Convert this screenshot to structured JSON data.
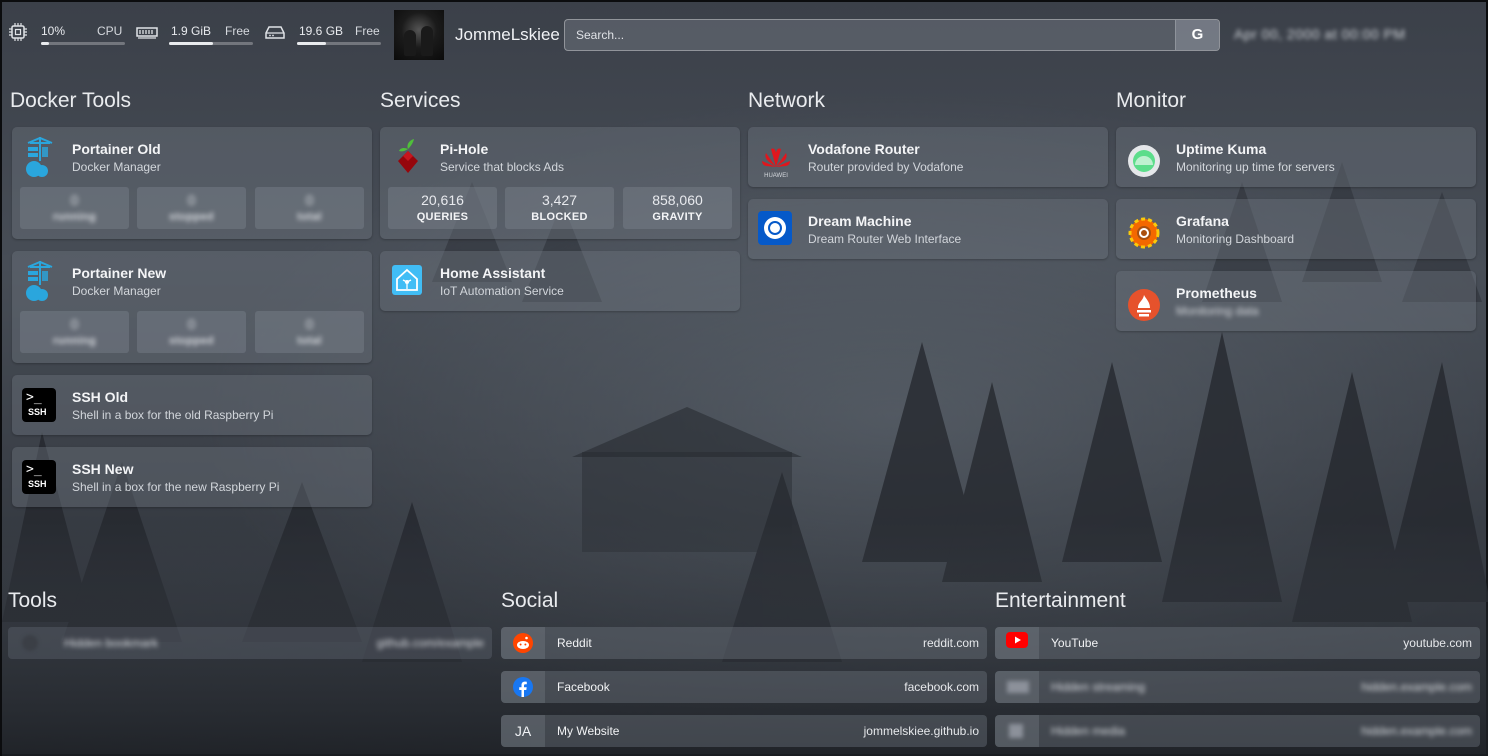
{
  "topbar": {
    "cpu": {
      "value": "10%",
      "label": "CPU",
      "percent": 10,
      "icon": "cpu-icon"
    },
    "ram": {
      "value": "1.9 GiB",
      "label": "Free",
      "percent": 52,
      "icon": "ram-icon"
    },
    "disk": {
      "value": "19.6 GB",
      "label": "Free",
      "percent": 35,
      "icon": "hard-drive-icon"
    },
    "username": "JommeLskiee",
    "search_placeholder": "Search...",
    "search_button": "G",
    "datetime": "Apr 00, 2000 at 00:00 PM"
  },
  "groups": {
    "docker": {
      "title": "Docker Tools",
      "cards": [
        {
          "name": "Portainer Old",
          "desc": "Docker Manager",
          "stats": [
            {
              "v": "0",
              "l": "running"
            },
            {
              "v": "0",
              "l": "stopped"
            },
            {
              "v": "0",
              "l": "total"
            }
          ]
        },
        {
          "name": "Portainer New",
          "desc": "Docker Manager",
          "stats": [
            {
              "v": "0",
              "l": "running"
            },
            {
              "v": "0",
              "l": "stopped"
            },
            {
              "v": "0",
              "l": "total"
            }
          ]
        },
        {
          "name": "SSH Old",
          "desc": "Shell in a box for the old Raspberry Pi",
          "icon_text": "SSH"
        },
        {
          "name": "SSH New",
          "desc": "Shell in a box for the new Raspberry Pi",
          "icon_text": "SSH"
        }
      ]
    },
    "services": {
      "title": "Services",
      "cards": [
        {
          "name": "Pi-Hole",
          "desc": "Service that blocks Ads",
          "stats": [
            {
              "v": "20,616",
              "l": "QUERIES"
            },
            {
              "v": "3,427",
              "l": "BLOCKED"
            },
            {
              "v": "858,060",
              "l": "GRAVITY"
            }
          ]
        },
        {
          "name": "Home Assistant",
          "desc": "IoT Automation Service"
        }
      ]
    },
    "network": {
      "title": "Network",
      "cards": [
        {
          "name": "Vodafone Router",
          "desc": "Router provided by Vodafone",
          "icon_text": "HUAWEI"
        },
        {
          "name": "Dream Machine",
          "desc": "Dream Router Web Interface"
        }
      ]
    },
    "monitor": {
      "title": "Monitor",
      "cards": [
        {
          "name": "Uptime Kuma",
          "desc": "Monitoring up time for servers"
        },
        {
          "name": "Grafana",
          "desc": "Monitoring Dashboard"
        },
        {
          "name": "Prometheus",
          "desc": "Monitoring data"
        }
      ]
    },
    "tools": {
      "title": "Tools",
      "links": [
        {
          "name": "Hidden bookmark",
          "url": "github.com/example"
        }
      ]
    },
    "social": {
      "title": "Social",
      "links": [
        {
          "name": "Reddit",
          "url": "reddit.com"
        },
        {
          "name": "Facebook",
          "url": "facebook.com"
        },
        {
          "name": "My Website",
          "url": "jommelskiee.github.io",
          "icon_text": "JA"
        }
      ]
    },
    "entertainment": {
      "title": "Entertainment",
      "links": [
        {
          "name": "YouTube",
          "url": "youtube.com"
        },
        {
          "name": "Hidden streaming",
          "url": "hidden.example.com"
        },
        {
          "name": "Hidden media",
          "url": "hidden.example.com"
        }
      ]
    }
  },
  "colors": {
    "accent_white": "#e9ebee",
    "card_bg": "rgba(110,116,126,0.42)",
    "docker_blue": "#2aa6dd",
    "pihole_red": "#96060c",
    "reddit": "#ff4500",
    "facebook": "#1877f2",
    "youtube": "#ff0000",
    "grafana": "#f46800",
    "prometheus": "#e6522c"
  }
}
